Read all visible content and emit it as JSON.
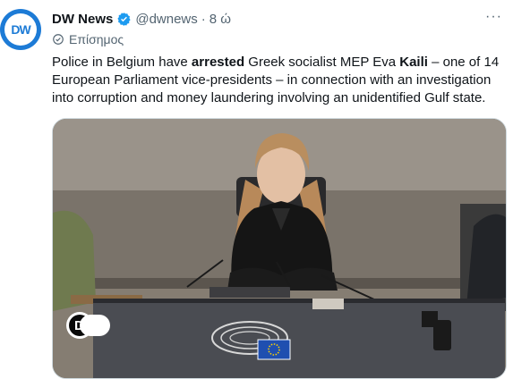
{
  "tweet": {
    "author_name": "DW News",
    "handle": "@dwnews",
    "separator": "·",
    "time": "8 ώ",
    "official_label": "Επίσημος",
    "more_label": "···",
    "text": {
      "part1": "Police in Belgium have ",
      "bold1": "arrested",
      "part2": " Greek socialist MEP Eva ",
      "bold2": "Kaili",
      "part3": " – one of 14 European Parliament vice-presidents – in connection with an investigation into corruption and money laundering involving an unidentified Gulf state."
    },
    "media": {
      "watermark": "DW"
    }
  },
  "icons": {
    "avatar": "dw-logo-icon",
    "verified": "verified-badge-icon",
    "official": "official-gear-icon",
    "more": "more-dots-icon"
  },
  "colors": {
    "brand": "#1d7bd6",
    "verified": "#1d9bf0",
    "muted": "#536471",
    "text": "#0f1419"
  }
}
